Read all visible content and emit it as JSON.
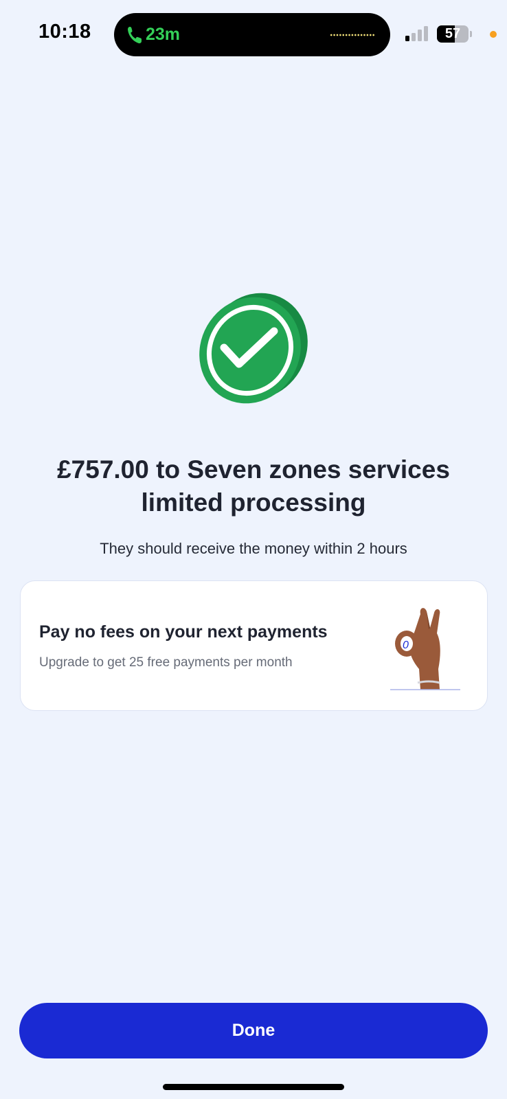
{
  "status_bar": {
    "time": "10:18",
    "call_duration": "23m",
    "battery_percent": "57",
    "battery_level": 0.57,
    "icons": [
      "phone-icon",
      "signal-icon",
      "battery-icon",
      "orange-dot"
    ]
  },
  "main": {
    "icon": "checkmark-circle-icon",
    "headline": "£757.00 to Seven zones services limited processing",
    "subline": "They should receive the money within 2 hours"
  },
  "promo": {
    "title": "Pay no fees on your next payments",
    "subtitle": "Upgrade to get 25 free payments per month",
    "illustration": "ok-hand-icon"
  },
  "footer": {
    "done_label": "Done"
  },
  "colors": {
    "background": "#eef3fd",
    "success_green": "#22a553",
    "primary_button": "#1a2ad3",
    "call_green": "#34d058"
  }
}
